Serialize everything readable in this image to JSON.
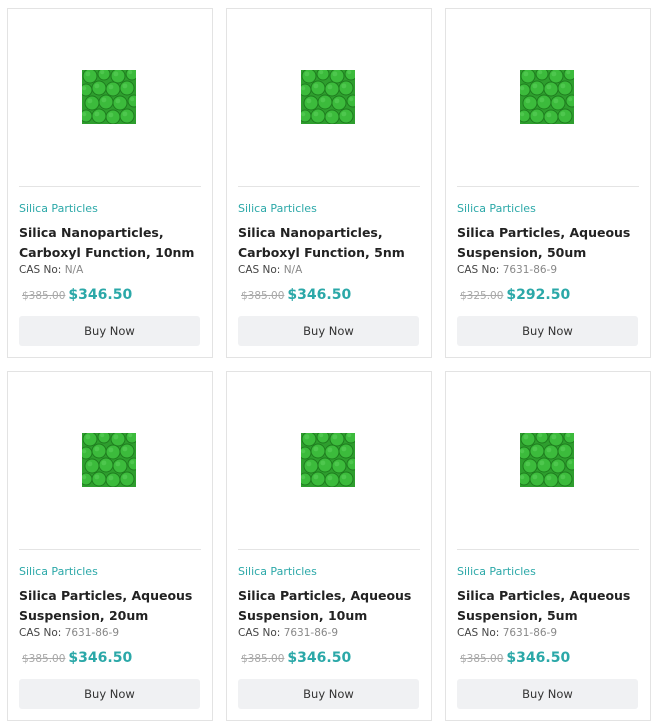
{
  "products": [
    {
      "category": "Silica Particles",
      "title": "Silica Nanoparticles, Carboxyl Function, 10nm",
      "cas_label": "CAS No:",
      "cas_value": "N/A",
      "old_price": "$385.00",
      "new_price": "$346.50",
      "button_label": "Buy Now"
    },
    {
      "category": "Silica Particles",
      "title": "Silica Nanoparticles, Carboxyl Function, 5nm",
      "cas_label": "CAS No:",
      "cas_value": "N/A",
      "old_price": "$385.00",
      "new_price": "$346.50",
      "button_label": "Buy Now"
    },
    {
      "category": "Silica Particles",
      "title": "Silica Particles, Aqueous Suspension, 50um",
      "cas_label": "CAS No:",
      "cas_value": "7631-86-9",
      "old_price": "$325.00",
      "new_price": "$292.50",
      "button_label": "Buy Now"
    },
    {
      "category": "Silica Particles",
      "title": "Silica Particles, Aqueous Suspension, 20um",
      "cas_label": "CAS No:",
      "cas_value": "7631-86-9",
      "old_price": "$385.00",
      "new_price": "$346.50",
      "button_label": "Buy Now"
    },
    {
      "category": "Silica Particles",
      "title": "Silica Particles, Aqueous Suspension, 10um",
      "cas_label": "CAS No:",
      "cas_value": "7631-86-9",
      "old_price": "$385.00",
      "new_price": "$346.50",
      "button_label": "Buy Now"
    },
    {
      "category": "Silica Particles",
      "title": "Silica Particles, Aqueous Suspension, 5um",
      "cas_label": "CAS No:",
      "cas_value": "7631-86-9",
      "old_price": "$385.00",
      "new_price": "$346.50",
      "button_label": "Buy Now"
    }
  ],
  "colors": {
    "accent": "#2ba8a8",
    "thumbnail_green": "#2e9e2e",
    "button_bg": "#f0f1f3"
  },
  "icons": {
    "thumbnail": "green-particles-image"
  }
}
